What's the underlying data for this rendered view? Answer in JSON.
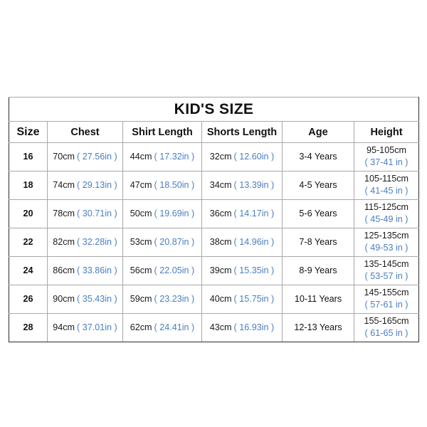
{
  "table": {
    "title": "KID'S SIZE",
    "columns": [
      {
        "key": "size",
        "label": "Size"
      },
      {
        "key": "chest",
        "label": "Chest"
      },
      {
        "key": "shirt",
        "label": "Shirt Length"
      },
      {
        "key": "shorts",
        "label": "Shorts Length"
      },
      {
        "key": "age",
        "label": "Age"
      },
      {
        "key": "height",
        "label": "Height"
      }
    ],
    "accent_color": "#4a7fc1",
    "text_color": "#111111",
    "border_color": "#2b2b2b",
    "rows": [
      {
        "size": "16",
        "chest_cm": "70cm",
        "chest_in": "( 27.56in )",
        "shirt_cm": "44cm",
        "shirt_in": "( 17.32in )",
        "shorts_cm": "32cm",
        "shorts_in": "( 12.60in )",
        "age": "3-4 Years",
        "height_cm": "95-105cm",
        "height_in": "( 37-41 in )"
      },
      {
        "size": "18",
        "chest_cm": "74cm",
        "chest_in": "( 29.13in )",
        "shirt_cm": "47cm",
        "shirt_in": "( 18.50in )",
        "shorts_cm": "34cm",
        "shorts_in": "( 13.39in )",
        "age": "4-5 Years",
        "height_cm": "105-115cm",
        "height_in": "( 41-45 in )"
      },
      {
        "size": "20",
        "chest_cm": "78cm",
        "chest_in": "( 30.71in )",
        "shirt_cm": "50cm",
        "shirt_in": "( 19.69in )",
        "shorts_cm": "36cm",
        "shorts_in": "( 14.17in )",
        "age": "5-6 Years",
        "height_cm": "115-125cm",
        "height_in": "( 45-49 in )"
      },
      {
        "size": "22",
        "chest_cm": "82cm",
        "chest_in": "( 32.28in )",
        "shirt_cm": "53cm",
        "shirt_in": "( 20.87in )",
        "shorts_cm": "38cm",
        "shorts_in": "( 14.96in )",
        "age": "7-8 Years",
        "height_cm": "125-135cm",
        "height_in": "( 49-53 in )"
      },
      {
        "size": "24",
        "chest_cm": "86cm",
        "chest_in": "( 33.86in )",
        "shirt_cm": "56cm",
        "shirt_in": "( 22.05in )",
        "shorts_cm": "39cm",
        "shorts_in": "( 15.35in )",
        "age": "8-9 Years",
        "height_cm": "135-145cm",
        "height_in": "( 53-57 in )"
      },
      {
        "size": "26",
        "chest_cm": "90cm",
        "chest_in": "( 35.43in )",
        "shirt_cm": "59cm",
        "shirt_in": "( 23.23in )",
        "shorts_cm": "40cm",
        "shorts_in": "( 15.75in )",
        "age": "10-11 Years",
        "height_cm": "145-155cm",
        "height_in": "( 57-61 in )"
      },
      {
        "size": "28",
        "chest_cm": "94cm",
        "chest_in": "( 37.01in )",
        "shirt_cm": "62cm",
        "shirt_in": "( 24.41in )",
        "shorts_cm": "43cm",
        "shorts_in": "( 16.93in )",
        "age": "12-13 Years",
        "height_cm": "155-165cm",
        "height_in": "( 61-65 in )"
      }
    ]
  }
}
